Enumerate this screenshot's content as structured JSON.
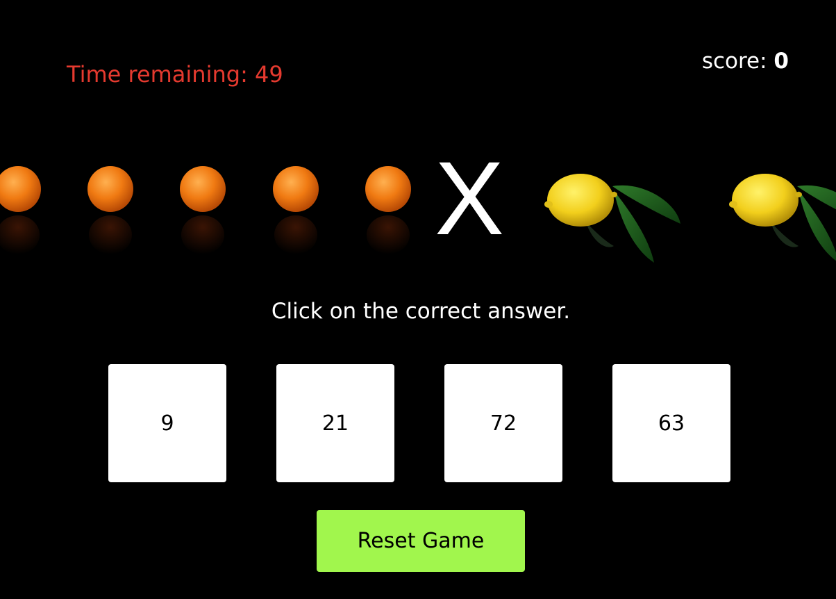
{
  "status": {
    "timer_text": "Time remaining: 49",
    "score_label": "score:",
    "score_value": "0"
  },
  "problem": {
    "left_fruit": "orange",
    "left_count": 5,
    "operator": "X",
    "right_fruit": "lemon",
    "right_count": 2
  },
  "instruction": "Click on the correct answer.",
  "answers": [
    "9",
    "21",
    "72",
    "63"
  ],
  "reset_label": "Reset Game",
  "colors": {
    "background": "#000000",
    "timer": "#e53a2f",
    "answer_box": "#ffffff",
    "reset_button": "#a1f64d"
  }
}
